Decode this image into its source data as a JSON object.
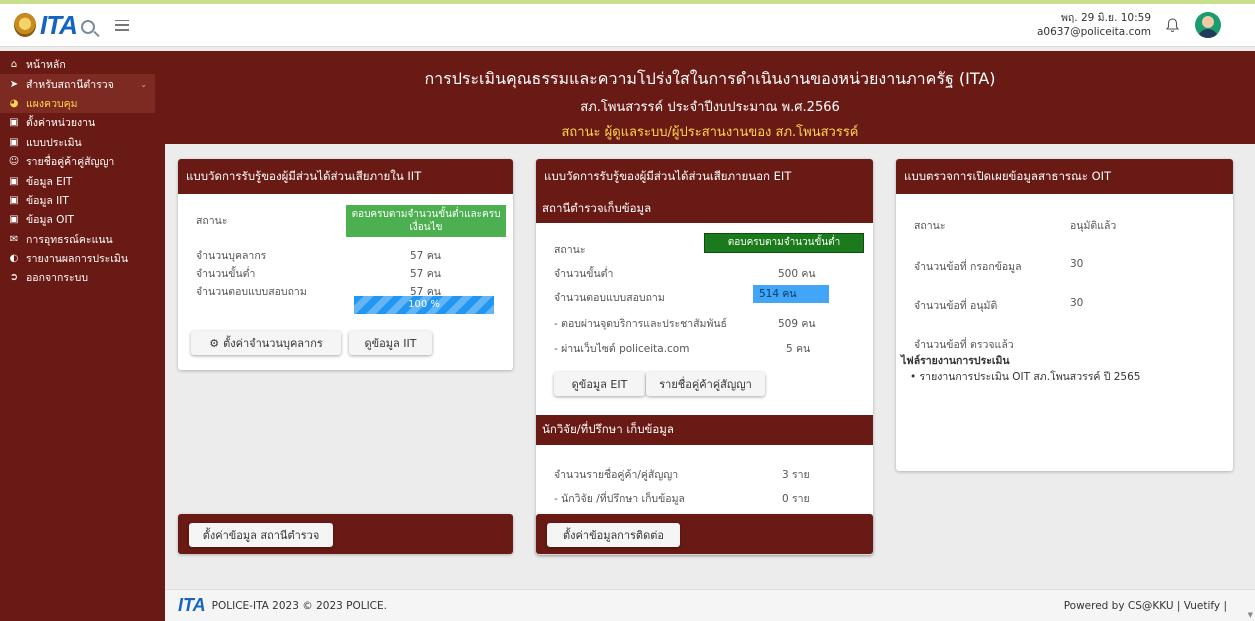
{
  "header": {
    "logo_text": "ITA",
    "datetime_line1": "พฤ. 29 มิ.ย. 10:59",
    "datetime_line2": "a0637@policeita.com"
  },
  "sidebar": {
    "items": [
      {
        "icon": "home-icon",
        "label": "หน้าหลัก"
      },
      {
        "icon": "chevron-circle-icon",
        "label": "สำหรับสถานีตำรวจ"
      },
      {
        "icon": "dashboard-icon",
        "label": "แผงควบคุม"
      },
      {
        "icon": "briefcase-icon",
        "label": "ตั้งค่าหน่วยงาน"
      },
      {
        "icon": "briefcase-icon",
        "label": "แบบประเมิน"
      },
      {
        "icon": "users-icon",
        "label": "รายชื่อคู่ค้าคู่สัญญา"
      },
      {
        "icon": "briefcase-icon",
        "label": "ข้อมูล EIT"
      },
      {
        "icon": "briefcase-icon",
        "label": "ข้อมูล IIT"
      },
      {
        "icon": "briefcase-icon",
        "label": "ข้อมูล OIT"
      },
      {
        "icon": "mail-icon",
        "label": "การอุทธรณ์คะแนน"
      },
      {
        "icon": "chart-pie-icon",
        "label": "รายงานผลการประเมิน"
      },
      {
        "icon": "logout-icon",
        "label": "ออกจากระบบ"
      }
    ]
  },
  "banner": {
    "title": "การประเมินคุณธรรมและความโปร่งใสในการดำเนินงานของหน่วยงานภาครัฐ (ITA)",
    "subtitle": "สภ.โพนสวรรค์ ประจำปีงบประมาณ พ.ศ.2566",
    "role": "สถานะ ผู้ดูแลระบบ/ผู้ประสานงานของ สภ.โพนสวรรค์"
  },
  "iit": {
    "title": "แบบวัดการรับรู้ของผู้มีส่วนได้ส่วนเสียภายใน IIT",
    "status_label": "สถานะ",
    "status_value": "ตอบครบตามจำนวนขั้นต่ำและครบเงื่อนไข",
    "personnel_label": "จำนวนบุคลากร",
    "personnel_value": "57 คน",
    "minimum_label": "จำนวนขั้นต่ำ",
    "minimum_value": "57 คน",
    "responses_label": "จำนวนตอบแบบสอบถาม",
    "responses_value": "57 คน",
    "progress_text": "100 %",
    "progress_fraction": 1.0,
    "btn_set_personnel": "ตั้งค่าจำนวนบุคลากร",
    "btn_view": "ดูข้อมูล IIT"
  },
  "eit": {
    "title": "แบบวัดการรับรู้ของผู้มีส่วนได้ส่วนเสียภายนอก EIT",
    "station_head": "สถานีตำรวจเก็บข้อมูล",
    "status_label": "สถานะ",
    "status_value": "ตอบครบตามจำนวนขั้นต่ำ",
    "minimum_label": "จำนวนขั้นต่ำ",
    "minimum_value": "500 คน",
    "responses_label": "จำนวนตอบแบบสอบถาม",
    "responses_value": "514 คน",
    "service_label": "- ตอบผ่านจุดบริการและประชาสัมพันธ์",
    "service_value": "509 คน",
    "web_label": "- ผ่านเว็บไซต์ policeita.com",
    "web_value": "5 คน",
    "btn_view": "ดูข้อมูล EIT",
    "btn_partners": "รายชื่อคู่ค้าคู่สัญญา",
    "research_head": "นักวิจัย/ที่ปรึกษา เก็บข้อมูล",
    "partners_label": "จำนวนรายชื่อคู่ค้า/คู่สัญญา",
    "partners_value": "3 ราย",
    "researcher_label": "- นักวิจัย /ที่ปรึกษา เก็บข้อมูล",
    "researcher_value": "0 ราย"
  },
  "oit": {
    "title": "แบบตรวจการเปิดเผยข้อมูลสาธารณะ OIT",
    "status_label": "สถานะ",
    "status_value": "อนุมัติแล้ว",
    "filled_label": "จำนวนข้อที่ กรอกข้อมูล",
    "filled_value": "30",
    "approved_label": "จำนวนข้อที่ อนุมัติ",
    "approved_value": "30",
    "checked_label": "จำนวนข้อที่ ตรวจแล้ว",
    "files_label": "ไฟล์รายงานการประเมิน",
    "file_item": "รายงานการประเมิน OIT สภ.โพนสวรรค์ ปี 2565"
  },
  "bottom": {
    "btn_station_settings": "ตั้งค่าข้อมูล สถานีตำรวจ",
    "btn_contact_settings": "ตั้งค่าข้อมูลการติดต่อ"
  },
  "footer": {
    "logo_text": "ITA",
    "copyright": "POLICE-ITA 2023 © 2023 POLICE.",
    "powered": "Powered by CS@KKU | Vuetify |"
  },
  "colors": {
    "brand_dark_red": "#6a1a14",
    "active_yellow": "#ffd54f",
    "status_green": "#4caf50",
    "status_dark_green": "#1b7a1b",
    "progress_blue": "#2196f3"
  }
}
